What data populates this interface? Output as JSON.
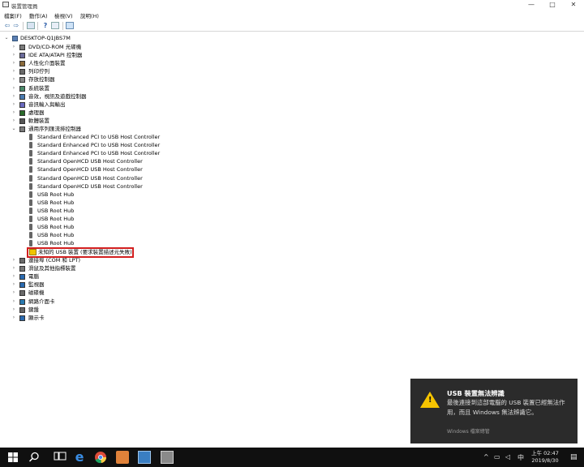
{
  "window": {
    "title": "裝置管理員",
    "minimize": "—",
    "maximize": "□",
    "close": "✕"
  },
  "menu": [
    "檔案(F)",
    "動作(A)",
    "檢視(V)",
    "說明(H)"
  ],
  "tree": {
    "root": "DESKTOP-Q1JBS7M",
    "categories": [
      "DVD/CD-ROM 光碟機",
      "IDE ATA/ATAPI 控制器",
      "人性化介面裝置",
      "列印佇列",
      "存放控制器",
      "系統裝置",
      "音效，視訊及遊戲控制器",
      "音訊輸入與輸出",
      "處理器",
      "軟體裝置",
      "通用序列匯流排控制器"
    ],
    "usb_children": [
      "Standard Enhanced PCI to USB Host Controller",
      "Standard Enhanced PCI to USB Host Controller",
      "Standard Enhanced PCI to USB Host Controller",
      "Standard OpenHCD USB Host Controller",
      "Standard OpenHCD USB Host Controller",
      "Standard OpenHCD USB Host Controller",
      "Standard OpenHCD USB Host Controller",
      "USB Root Hub",
      "USB Root Hub",
      "USB Root Hub",
      "USB Root Hub",
      "USB Root Hub",
      "USB Root Hub",
      "USB Root Hub"
    ],
    "unknown_device": "未知的 USB 裝置 (要求裝置描述元失敗)",
    "after_categories": [
      "連接埠 (COM 和 LPT)",
      "滑鼠及其他指標裝置",
      "電腦",
      "監視器",
      "磁碟機",
      "網路介面卡",
      "鍵盤",
      "顯示卡"
    ]
  },
  "toast": {
    "title": "USB 裝置無法辨識",
    "body": "最後連接到這部電腦的 USB 裝置已經無法作用，而且 Windows 無法辨識它。",
    "source": "Windows 檔案總管"
  },
  "taskbar": {
    "time_line1": "上午 02:47",
    "date_line2": "2019/8/30",
    "ime": "中"
  }
}
